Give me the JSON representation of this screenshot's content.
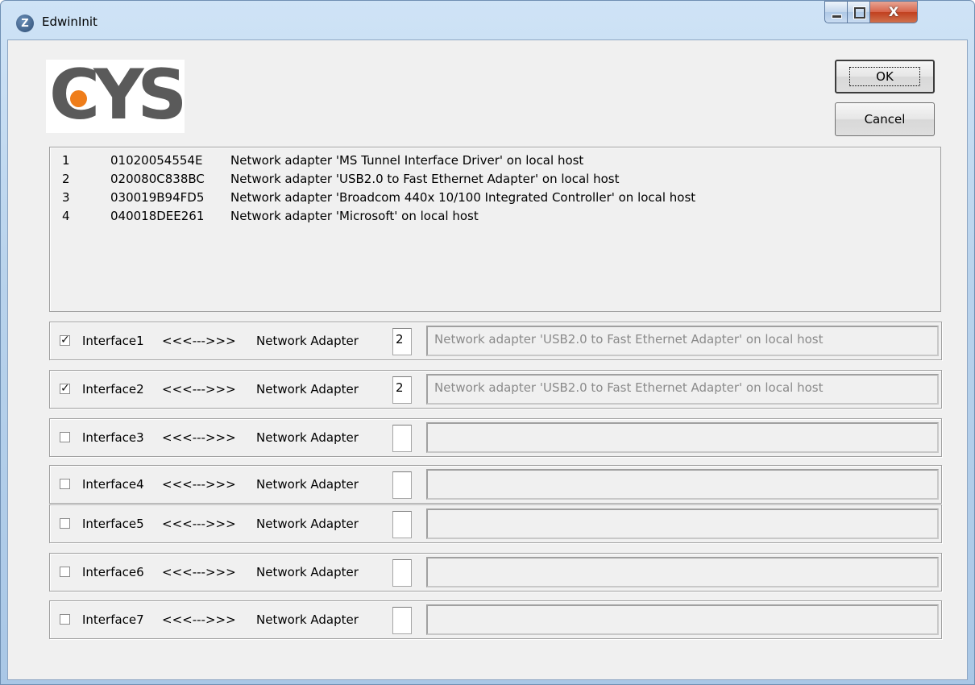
{
  "window": {
    "title": "EdwinInit",
    "icon": "app-z-icon",
    "close_glyph": "X"
  },
  "logo": {
    "text": "CYS",
    "accent_color": "#ef7d1a"
  },
  "buttons": {
    "ok_label": "OK",
    "cancel_label": "Cancel"
  },
  "adapters": [
    {
      "index": "1",
      "id": "01020054554E",
      "description": "Network adapter 'MS Tunnel Interface Driver' on local host"
    },
    {
      "index": "2",
      "id": "020080C838BC",
      "description": "Network adapter 'USB2.0 to Fast Ethernet Adapter' on local host"
    },
    {
      "index": "3",
      "id": "030019B94FD5",
      "description": "Network adapter 'Broadcom 440x 10/100 Integrated Controller' on local host"
    },
    {
      "index": "4",
      "id": "040018DEE261",
      "description": "Network adapter 'Microsoft' on local host"
    }
  ],
  "interfaces": [
    {
      "label": "Interface1",
      "arrows": "<<<--->>>",
      "adapter_label": "Network Adapter",
      "checked": true,
      "check_mark": "✓",
      "number": "2",
      "adapter_name": "Network adapter 'USB2.0 to Fast Ethernet Adapter' on local host"
    },
    {
      "label": "Interface2",
      "arrows": "<<<--->>>",
      "adapter_label": "Network Adapter",
      "checked": true,
      "check_mark": "✓",
      "number": "2",
      "adapter_name": "Network adapter 'USB2.0 to Fast Ethernet Adapter' on local host"
    },
    {
      "label": "Interface3",
      "arrows": "<<<--->>>",
      "adapter_label": "Network Adapter",
      "checked": false,
      "check_mark": "",
      "number": "",
      "adapter_name": ""
    },
    {
      "label": "Interface4",
      "arrows": "<<<--->>>",
      "adapter_label": "Network Adapter",
      "checked": false,
      "check_mark": "",
      "number": "",
      "adapter_name": ""
    },
    {
      "label": "Interface5",
      "arrows": "<<<--->>>",
      "adapter_label": "Network Adapter",
      "checked": false,
      "check_mark": "",
      "number": "",
      "adapter_name": ""
    },
    {
      "label": "Interface6",
      "arrows": "<<<--->>>",
      "adapter_label": "Network Adapter",
      "checked": false,
      "check_mark": "",
      "number": "",
      "adapter_name": ""
    },
    {
      "label": "Interface7",
      "arrows": "<<<--->>>",
      "adapter_label": "Network Adapter",
      "checked": false,
      "check_mark": "",
      "number": "",
      "adapter_name": ""
    }
  ]
}
